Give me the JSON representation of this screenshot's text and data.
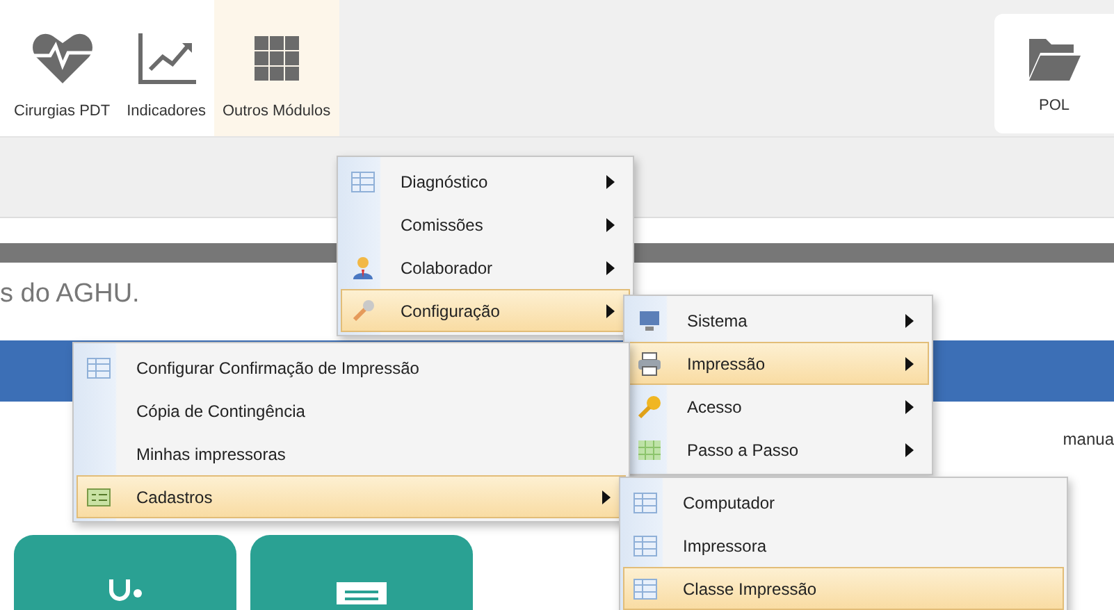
{
  "toolbar": {
    "buttons": [
      {
        "label": "Cirurgias PDT",
        "kind": "heart",
        "selected": false
      },
      {
        "label": "Indicadores",
        "kind": "chart",
        "selected": false
      },
      {
        "label": "Outros Módulos",
        "kind": "grid",
        "selected": true
      }
    ],
    "pol": {
      "label": "POL"
    }
  },
  "page": {
    "heading": "s do AGHU.",
    "side_text": "manua"
  },
  "menus": [
    {
      "items": [
        {
          "label": "Diagnóstico",
          "kind": "table",
          "submenu": true,
          "selected": false
        },
        {
          "label": "Comissões",
          "kind": "plain",
          "submenu": true,
          "selected": false
        },
        {
          "label": "Colaborador",
          "kind": "person",
          "submenu": true,
          "selected": false
        },
        {
          "label": "Configuração",
          "kind": "wrench",
          "submenu": true,
          "selected": true
        }
      ]
    },
    {
      "items": [
        {
          "label": "Sistema",
          "kind": "monitor",
          "submenu": true,
          "selected": false
        },
        {
          "label": "Impressão",
          "kind": "printer",
          "submenu": true,
          "selected": true
        },
        {
          "label": "Acesso",
          "kind": "key",
          "submenu": true,
          "selected": false
        },
        {
          "label": "Passo a Passo",
          "kind": "sheet",
          "submenu": true,
          "selected": false
        }
      ]
    },
    {
      "items": [
        {
          "label": "Configurar Confirmação de Impressão",
          "kind": "table",
          "submenu": false,
          "selected": false
        },
        {
          "label": "Cópia de Contingência",
          "kind": "plain",
          "submenu": false,
          "selected": false
        },
        {
          "label": "Minhas impressoras",
          "kind": "plain",
          "submenu": false,
          "selected": false
        },
        {
          "label": "Cadastros",
          "kind": "form",
          "submenu": true,
          "selected": true
        }
      ]
    },
    {
      "items": [
        {
          "label": "Computador",
          "kind": "table",
          "submenu": false,
          "selected": false
        },
        {
          "label": "Impressora",
          "kind": "table",
          "submenu": false,
          "selected": false
        },
        {
          "label": "Classe Impressão",
          "kind": "table",
          "submenu": false,
          "selected": true
        }
      ]
    }
  ]
}
